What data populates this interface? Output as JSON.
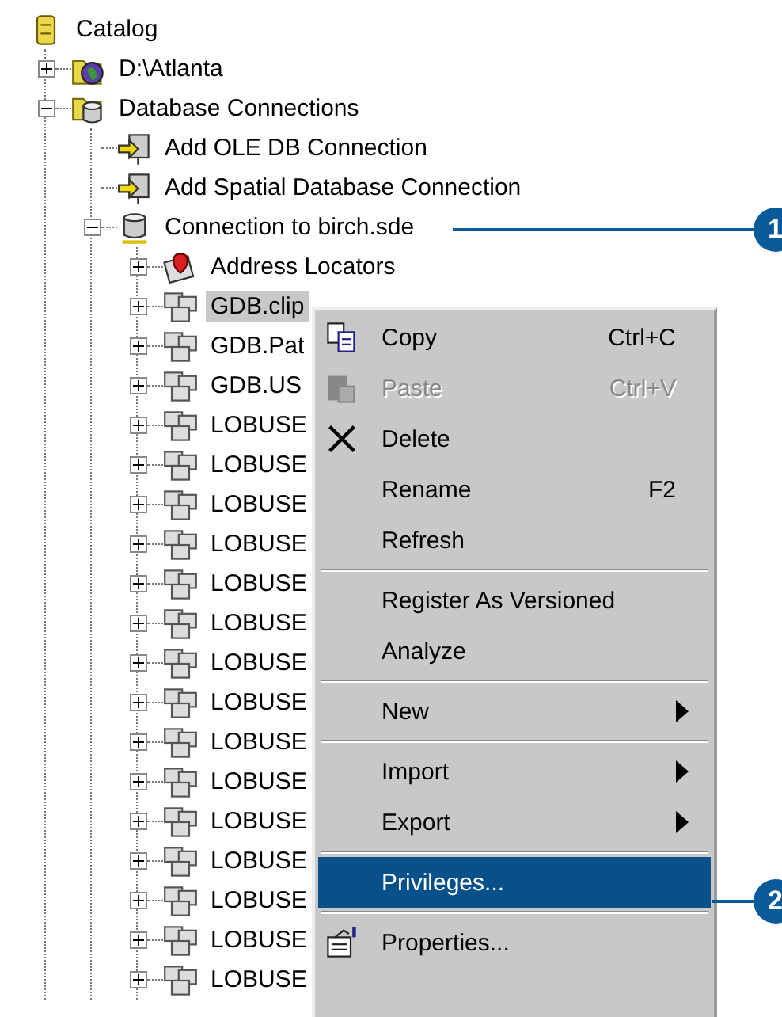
{
  "tree": {
    "label": "Catalog",
    "kind": "catalog",
    "children": [
      {
        "label": "D:\\Atlanta",
        "kind": "folder-globe",
        "expanded": false,
        "selected": false
      },
      {
        "label": "Database Connections",
        "kind": "database-folder",
        "expanded": true,
        "selected": false,
        "children": [
          {
            "label": "Add OLE DB Connection",
            "kind": "add-connection",
            "selected": false
          },
          {
            "label": "Add Spatial Database Connection",
            "kind": "add-connection",
            "selected": false
          },
          {
            "label": "Connection to birch.sde",
            "kind": "database",
            "expanded": true,
            "selected": false,
            "children": [
              {
                "label": "Address Locators",
                "kind": "locators",
                "expanded": false,
                "selected": false
              },
              {
                "label": "GDB.clip",
                "kind": "dataset",
                "expanded": false,
                "selected": true
              },
              {
                "label": "GDB.Pat",
                "kind": "dataset",
                "expanded": false,
                "selected": false
              },
              {
                "label": "GDB.US",
                "kind": "dataset",
                "expanded": false,
                "selected": false
              },
              {
                "label": "LOBUSE",
                "kind": "dataset",
                "expanded": false,
                "selected": false
              },
              {
                "label": "LOBUSE",
                "kind": "dataset",
                "expanded": false,
                "selected": false
              },
              {
                "label": "LOBUSE",
                "kind": "dataset",
                "expanded": false,
                "selected": false
              },
              {
                "label": "LOBUSE",
                "kind": "dataset",
                "expanded": false,
                "selected": false
              },
              {
                "label": "LOBUSE",
                "kind": "dataset",
                "expanded": false,
                "selected": false
              },
              {
                "label": "LOBUSE",
                "kind": "dataset",
                "expanded": false,
                "selected": false
              },
              {
                "label": "LOBUSE",
                "kind": "dataset",
                "expanded": false,
                "selected": false
              },
              {
                "label": "LOBUSE",
                "kind": "dataset",
                "expanded": false,
                "selected": false
              },
              {
                "label": "LOBUSE",
                "kind": "dataset",
                "expanded": false,
                "selected": false
              },
              {
                "label": "LOBUSE",
                "kind": "dataset",
                "expanded": false,
                "selected": false
              },
              {
                "label": "LOBUSE",
                "kind": "dataset",
                "expanded": false,
                "selected": false
              },
              {
                "label": "LOBUSE",
                "kind": "dataset",
                "expanded": false,
                "selected": false
              },
              {
                "label": "LOBUSE",
                "kind": "dataset",
                "expanded": false,
                "selected": false
              },
              {
                "label": "LOBUSE",
                "kind": "dataset",
                "expanded": false,
                "selected": false
              },
              {
                "label": "LOBUSE",
                "kind": "dataset",
                "expanded": false,
                "selected": false
              }
            ]
          }
        ]
      }
    ]
  },
  "context_menu": [
    {
      "kind": "copy",
      "label": "Copy",
      "shortcut": "Ctrl+C",
      "disabled": false,
      "selected": false
    },
    {
      "kind": "paste",
      "label": "Paste",
      "shortcut": "Ctrl+V",
      "disabled": true,
      "selected": false
    },
    {
      "kind": "delete",
      "label": "Delete",
      "disabled": false,
      "selected": false
    },
    {
      "kind": "item",
      "label": "Rename",
      "shortcut": "F2",
      "disabled": false,
      "selected": false
    },
    {
      "kind": "item",
      "label": "Refresh",
      "disabled": false,
      "selected": false
    },
    {
      "kind": "separator"
    },
    {
      "kind": "item",
      "label": "Register As Versioned",
      "disabled": false,
      "selected": false
    },
    {
      "kind": "item",
      "label": "Analyze",
      "disabled": false,
      "selected": false
    },
    {
      "kind": "separator"
    },
    {
      "kind": "item",
      "label": "New",
      "submenu": true,
      "disabled": false,
      "selected": false
    },
    {
      "kind": "separator"
    },
    {
      "kind": "item",
      "label": "Import",
      "submenu": true,
      "disabled": false,
      "selected": false
    },
    {
      "kind": "item",
      "label": "Export",
      "submenu": true,
      "disabled": false,
      "selected": false
    },
    {
      "kind": "separator"
    },
    {
      "kind": "item",
      "label": "Privileges...",
      "disabled": false,
      "selected": true
    },
    {
      "kind": "separator"
    },
    {
      "kind": "properties",
      "label": "Properties...",
      "disabled": false,
      "selected": false
    }
  ],
  "callouts": [
    {
      "number": "1"
    },
    {
      "number": "2"
    }
  ]
}
